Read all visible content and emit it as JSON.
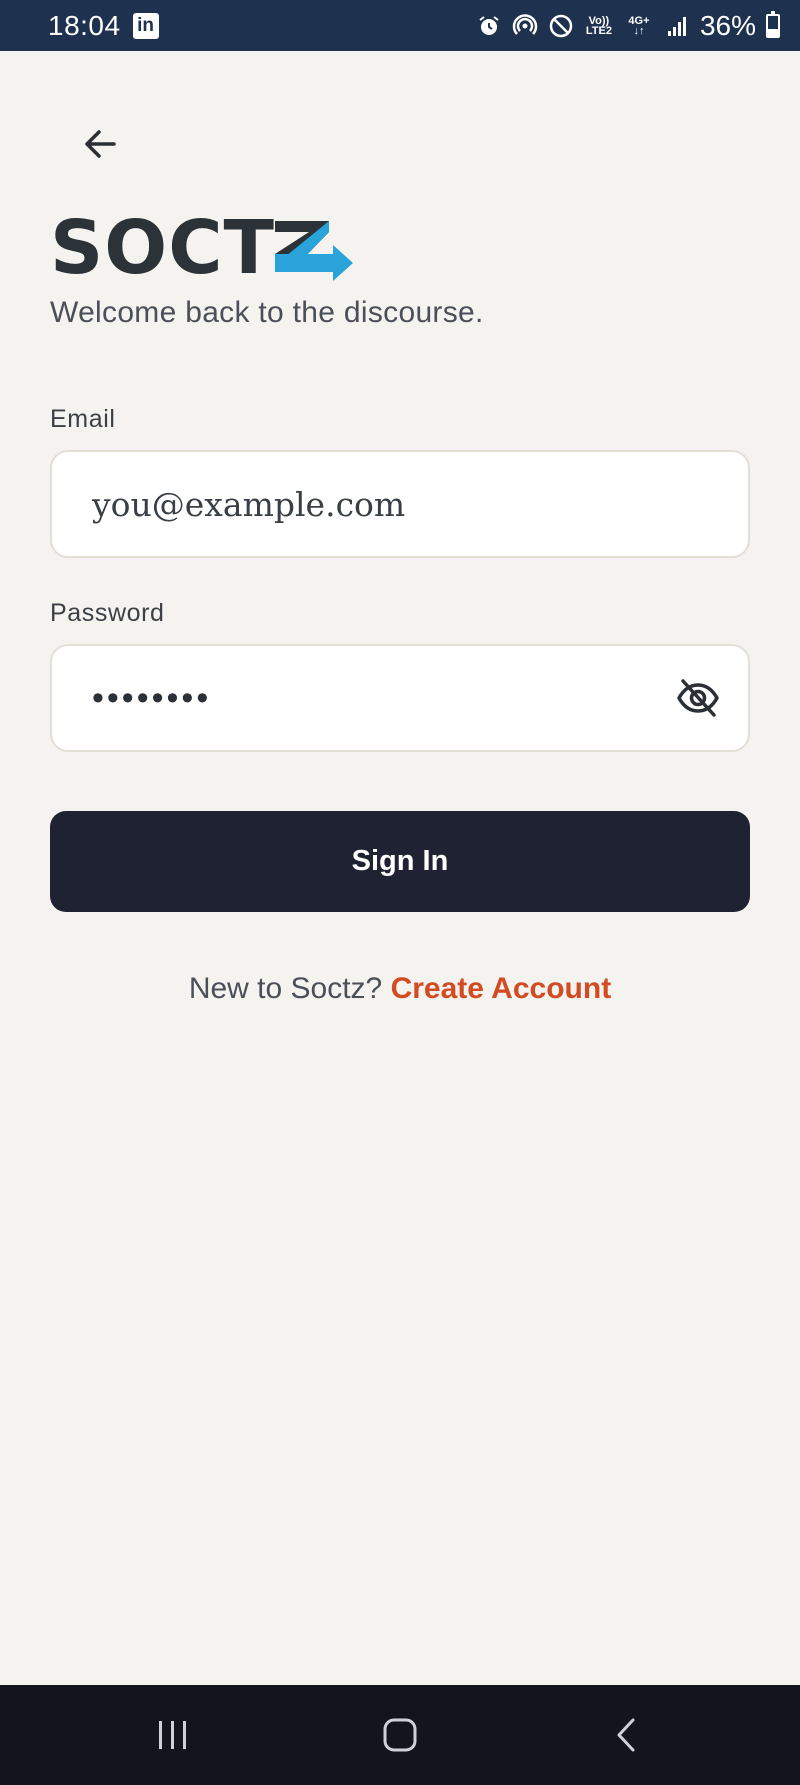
{
  "status_bar": {
    "time": "18:04",
    "linkedin_icon": "linkedin-icon",
    "volte_label_top": "Vo))",
    "volte_label_bottom": "LTE2",
    "network_label": "4G+",
    "battery": "36%"
  },
  "header": {
    "back_icon": "arrow-left-icon"
  },
  "brand": {
    "logo_text": "SOCT",
    "tagline": "Welcome back to the discourse.",
    "accent_color": "#29a3d9"
  },
  "form": {
    "email_label": "Email",
    "email_placeholder": "you@example.com",
    "email_value": "",
    "password_label": "Password",
    "password_value": "••••••••",
    "password_toggle_icon": "eye-off-icon",
    "submit_label": "Sign In"
  },
  "signup": {
    "prompt": "New to Soctz?",
    "link_label": "Create Account",
    "link_color": "#d24b23"
  },
  "nav_bar": {
    "items": [
      "recent-apps-icon",
      "home-icon",
      "back-icon"
    ]
  }
}
